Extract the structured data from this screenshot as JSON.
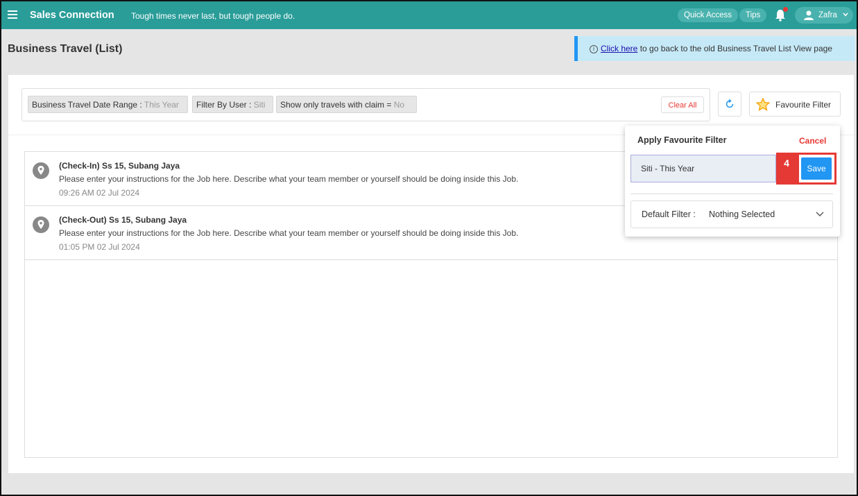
{
  "topbar": {
    "brand": "Sales Connection",
    "tagline": "Tough times never last, but tough people do.",
    "quick_access": "Quick Access",
    "tips": "Tips",
    "user_name": "Zafra",
    "accent_color": "#2a9d99"
  },
  "page": {
    "title": "Business Travel (List)"
  },
  "banner": {
    "link_text": "Click here",
    "text": " to go back to the old Business Travel List View page"
  },
  "filters": {
    "chips": [
      {
        "label": "Business Travel Date Range",
        "sep": " : ",
        "value": "This Year"
      },
      {
        "label": "Filter By User",
        "sep": " : ",
        "value": "Siti"
      },
      {
        "label": "Show only travels with claim",
        "sep": " = ",
        "value": "No"
      }
    ],
    "clear_all": "Clear All",
    "favourite_filter": "Favourite Filter"
  },
  "travels": [
    {
      "title": "(Check-In) Ss 15, Subang Jaya",
      "description": "Please enter your instructions for the Job here. Describe what your team member or yourself should be doing inside this Job.",
      "time": "09:26 AM  02 Jul 2024"
    },
    {
      "title": "(Check-Out) Ss 15, Subang Jaya",
      "description": "Please enter your instructions for the Job here. Describe what your team member or yourself should be doing inside this Job.",
      "time": "01:05 PM  02 Jul 2024"
    }
  ],
  "favourite_popover": {
    "title": "Apply Favourite Filter",
    "cancel": "Cancel",
    "name_value": "Siti - This Year",
    "step_badge": "4",
    "save": "Save",
    "default_filter_label": "Default Filter :",
    "default_filter_value": "Nothing Selected"
  }
}
